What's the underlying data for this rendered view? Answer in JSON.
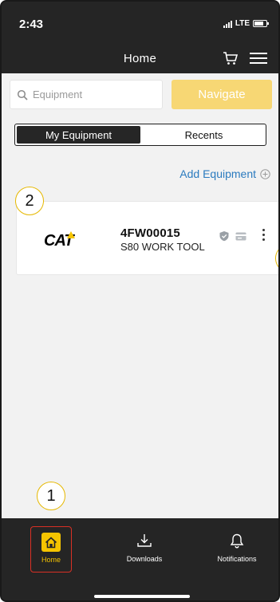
{
  "status_bar": {
    "time": "2:43",
    "network": "LTE"
  },
  "header": {
    "title": "Home",
    "cart_icon": "cart-icon",
    "menu_icon": "hamburger-menu-icon"
  },
  "search": {
    "placeholder": "Equipment",
    "value": ""
  },
  "navigate_button": {
    "label": "Navigate",
    "color": "#f7d774"
  },
  "toggle": {
    "options": [
      "My Equipment",
      "Recents"
    ],
    "selected": "My Equipment"
  },
  "add_equipment": {
    "label": "Add Equipment",
    "color": "#2b7bbf"
  },
  "equipment_card": {
    "brand": "CAT",
    "id": "4FW00015",
    "model": "S80 WORK TOOL",
    "icons": [
      "shield-icon",
      "card-icon",
      "kebab-menu-icon"
    ]
  },
  "markers": {
    "one": "1",
    "two": "2"
  },
  "tab_bar": {
    "tabs": [
      {
        "label": "Home",
        "icon": "home-icon",
        "active": true
      },
      {
        "label": "Downloads",
        "icon": "download-icon",
        "active": false
      },
      {
        "label": "Notifications",
        "icon": "bell-icon",
        "active": false
      }
    ],
    "accent": "#f5c400",
    "highlight_border": "#d93025"
  }
}
